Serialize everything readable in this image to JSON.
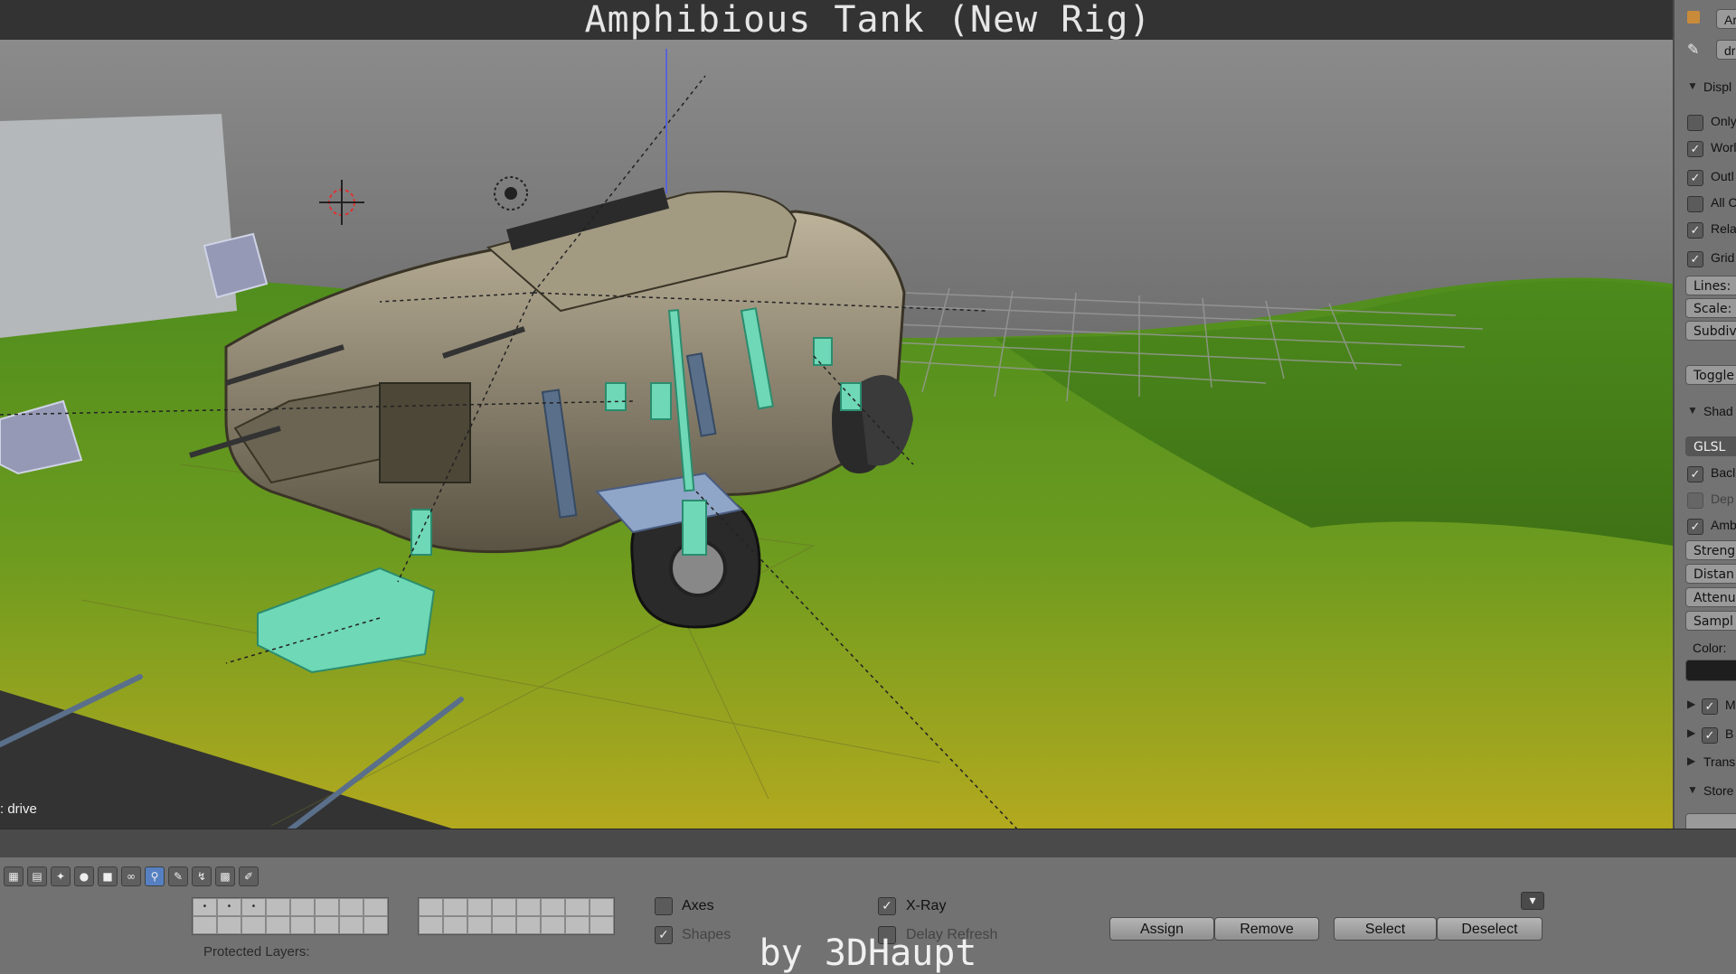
{
  "video": {
    "title": "Amphibious Tank (New Rig)",
    "credit": "by 3DHaupt"
  },
  "viewport": {
    "mode_label": ": drive"
  },
  "right_panel": {
    "top_fields": [
      "Ar",
      "dr"
    ],
    "display_header": "Displ",
    "display_options": [
      {
        "label": "Only",
        "checked": false
      },
      {
        "label": "Worl",
        "checked": true
      },
      {
        "label": "Outl",
        "checked": true
      },
      {
        "label": "All C",
        "checked": false
      },
      {
        "label": "Rela",
        "checked": true
      },
      {
        "label": "Grid",
        "checked": true
      }
    ],
    "grid_fields": [
      "Lines:",
      "Scale:",
      "Subdiv"
    ],
    "toggle_button": "Toggle",
    "shading_header": "Shad",
    "shading_mode": "GLSL",
    "shading_options": [
      {
        "label": "Bacl",
        "checked": true
      },
      {
        "label": "Dep",
        "checked": false
      },
      {
        "label": "Amb",
        "checked": true
      }
    ],
    "ao_fields": [
      "Streng",
      "Distan",
      "Attenu",
      "Sampl"
    ],
    "color_label": "Color:",
    "collapsed_sections": [
      {
        "label": "M",
        "checked": true
      },
      {
        "label": "B",
        "checked": true
      }
    ],
    "transform_header": "Trans",
    "store_header": "Store"
  },
  "toolbar": {
    "icons": [
      "scene-icon",
      "render-layers-icon",
      "world-icon",
      "object-icon",
      "object-data-icon",
      "constraints-icon",
      "armature-icon",
      "bone-icon",
      "bone-constraint-icon",
      "texture-icon",
      "pose-icon"
    ],
    "active_index": 6
  },
  "properties": {
    "layer_marks": [
      "•",
      "•",
      "•"
    ],
    "protected_layers_label": "Protected Layers:",
    "axes": {
      "label": "Axes",
      "checked": false
    },
    "shapes": {
      "label": "Shapes",
      "checked": true
    },
    "xray": {
      "label": "X-Ray",
      "checked": true
    },
    "delay_refresh": {
      "label": "Delay Refresh",
      "checked": false
    },
    "buttons": {
      "assign": "Assign",
      "remove": "Remove",
      "select": "Select",
      "deselect": "Deselect"
    }
  }
}
